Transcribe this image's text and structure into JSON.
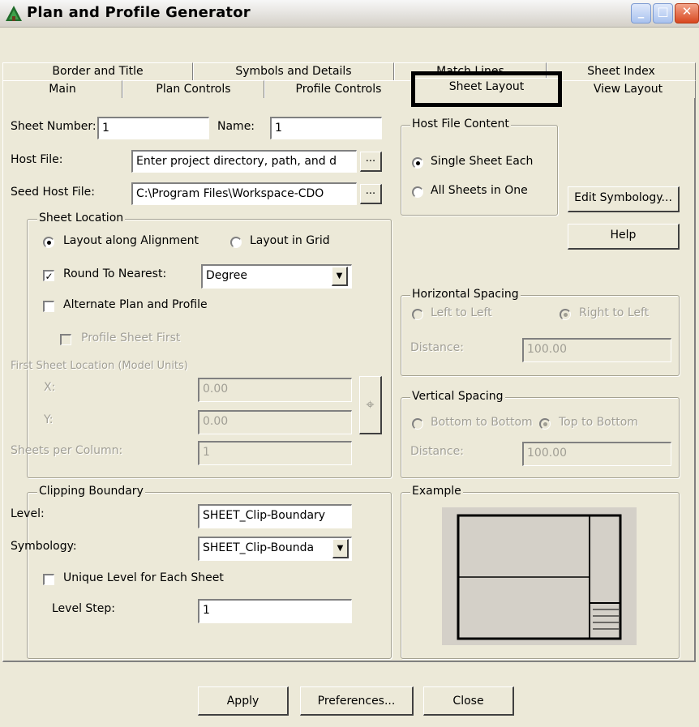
{
  "window": {
    "title": "Plan and Profile Generator",
    "icon": "app-icon",
    "controls": [
      "minimize-button",
      "maximize-button",
      "close-button"
    ]
  },
  "tabs": {
    "row1": [
      "Border and Title",
      "Symbols and Details",
      "Match Lines",
      "Sheet Index"
    ],
    "row2": [
      "Main",
      "Plan Controls",
      "Profile Controls",
      "Sheet Layout",
      "View Layout"
    ],
    "active": "Sheet Layout"
  },
  "fields": {
    "sheet_number_label": "Sheet Number:",
    "sheet_number_value": "1",
    "name_label": "Name:",
    "name_value": "1",
    "host_file_label": "Host File:",
    "host_file_value": "Enter project directory, path, and d",
    "seed_host_file_label": "Seed Host File:",
    "seed_host_file_value": "C:\\Program Files\\Workspace-CDO",
    "browse_label": "..."
  },
  "host_file_content": {
    "legend": "Host File Content",
    "single": "Single Sheet Each",
    "all": "All Sheets in One",
    "selected": "single"
  },
  "buttons": {
    "edit_symbology": "Edit Symbology...",
    "help": "Help",
    "apply": "Apply",
    "preferences": "Preferences...",
    "close": "Close"
  },
  "sheet_location": {
    "legend": "Sheet Location",
    "along_alignment": "Layout along Alignment",
    "in_grid": "Layout in Grid",
    "selected": "along_alignment",
    "round_to_nearest": "Round To Nearest:",
    "round_checked": true,
    "round_value": "Degree",
    "alternate": "Alternate Plan and Profile",
    "alternate_checked": false,
    "profile_first": "Profile Sheet First",
    "first_location": "First Sheet Location (Model Units)",
    "x_label": "X:",
    "x_value": "0.00",
    "y_label": "Y:",
    "y_value": "0.00",
    "sheets_per_column_label": "Sheets per Column:",
    "sheets_per_column_value": "1"
  },
  "horizontal_spacing": {
    "legend": "Horizontal Spacing",
    "left_to_left": "Left to Left",
    "right_to_left": "Right to Left",
    "distance_label": "Distance:",
    "distance_value": "100.00"
  },
  "vertical_spacing": {
    "legend": "Vertical Spacing",
    "bottom_to_bottom": "Bottom to Bottom",
    "top_to_bottom": "Top to Bottom",
    "distance_label": "Distance:",
    "distance_value": "100.00"
  },
  "clipping": {
    "legend": "Clipping Boundary",
    "level_label": "Level:",
    "level_value": "SHEET_Clip-Boundary",
    "symbology_label": "Symbology:",
    "symbology_value": "SHEET_Clip-Bounda",
    "unique_level": "Unique Level for Each Sheet",
    "unique_checked": false,
    "level_step_label": "Level Step:",
    "level_step_value": "1"
  },
  "example": {
    "legend": "Example"
  },
  "colors": {
    "dialog_bg": "#ece9d8",
    "example_bg": "#d4d0c8",
    "highlight": "#000000"
  }
}
